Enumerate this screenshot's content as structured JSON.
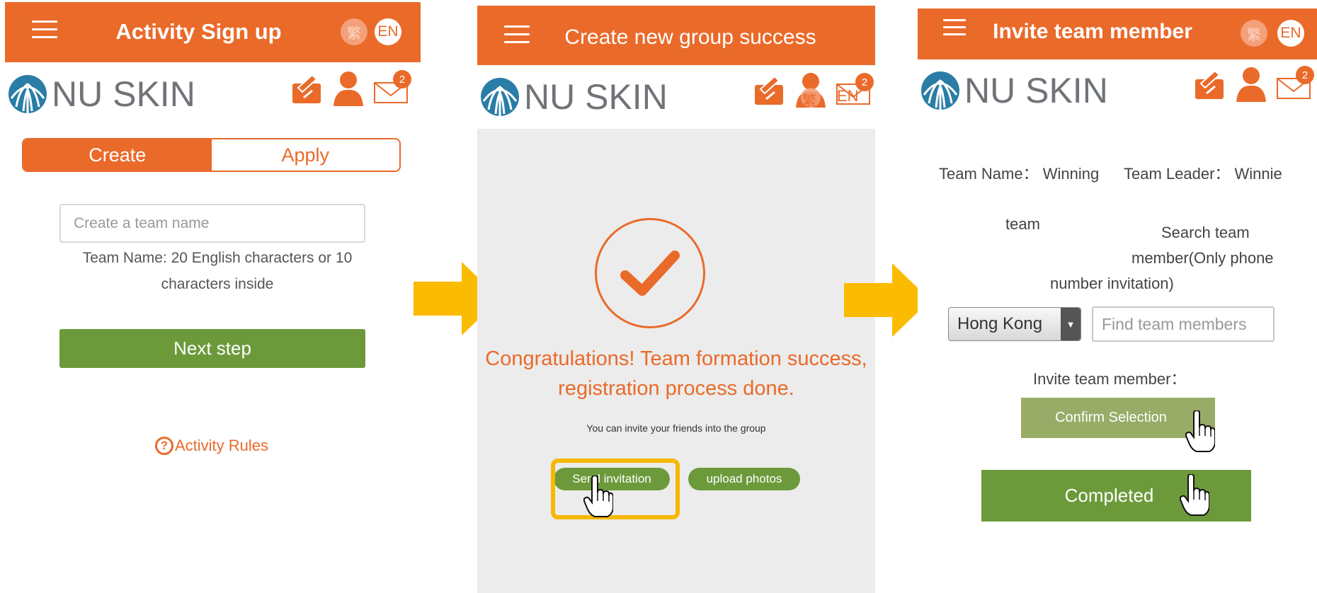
{
  "colors": {
    "brand_orange": "#ea6a2a",
    "green": "#6c9a3b",
    "confirm_green": "#98ac68",
    "highlight_yellow": "#f6b800",
    "arrow_yellow": "#fbbb00"
  },
  "common": {
    "logo_text": "NU SKIN",
    "lang_zh": "繁",
    "lang_en": "EN",
    "mail_badge": "2"
  },
  "step1": {
    "title": "Activity Sign up",
    "tabs": [
      "Create",
      "Apply"
    ],
    "active_tab": "Create",
    "team_name_placeholder": "Create a team name",
    "hint_line1": "Team Name: 20 English characters or 10",
    "hint_line2": "characters inside",
    "next_button": "Next step",
    "rules_icon": "?",
    "rules_link": "Activity Rules"
  },
  "step2": {
    "title": "Create new group success",
    "icon_overlay_lang_en": "EN",
    "congrats_line1": "Congratulations! Team formation success,",
    "congrats_line2": "registration process done.",
    "invite_hint": "You can invite your friends into the group",
    "send_invitation": "Send invitation",
    "upload_photos": "upload photos"
  },
  "step3": {
    "title": "Invite team member",
    "team_name_label": "Team Name： Winning",
    "team_name_wrap": "team",
    "team_leader": "Team Leader： Winnie",
    "search_line1": "Search team",
    "search_line2": "member(Only phone",
    "search_line3": "number invitation)",
    "region": "Hong Kong",
    "find_placeholder": "Find team members",
    "invite_label": "Invite team member：",
    "confirm_button": "Confirm Selection",
    "completed_button": "Completed"
  }
}
